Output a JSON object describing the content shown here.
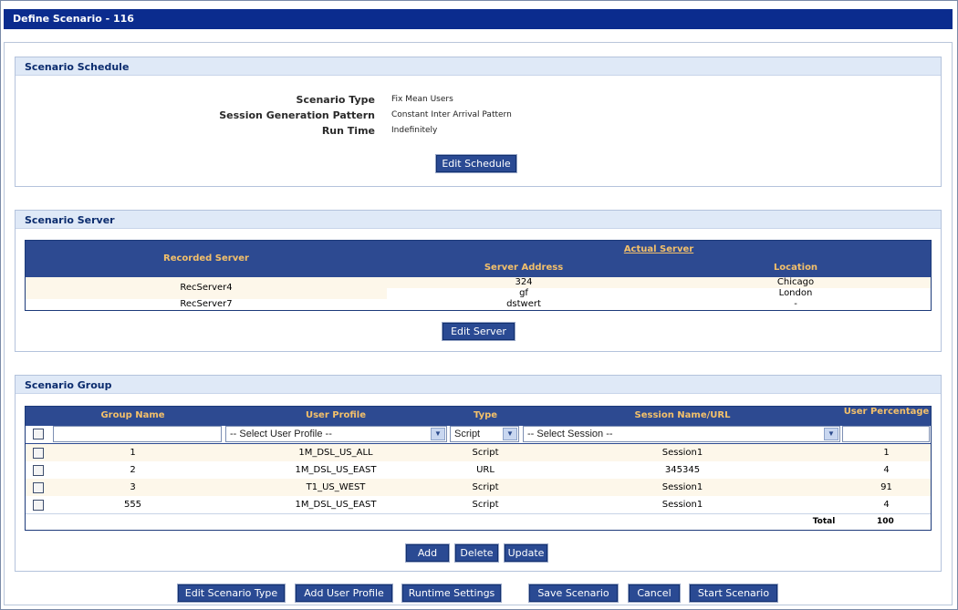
{
  "window": {
    "title": "Define Scenario - 116"
  },
  "schedule": {
    "title": "Scenario Schedule",
    "rows": [
      {
        "label": "Scenario Type",
        "value": "Fix Mean Users"
      },
      {
        "label": "Session Generation Pattern",
        "value": "Constant Inter Arrival Pattern"
      },
      {
        "label": "Run Time",
        "value": "Indefinitely"
      }
    ],
    "edit_button": "Edit Schedule"
  },
  "server": {
    "title": "Scenario Server",
    "headers": {
      "recorded": "Recorded Server",
      "actual": "Actual Server",
      "address": "Server Address",
      "location": "Location"
    },
    "rows": [
      {
        "recorded": "RecServer4",
        "addresses": [
          "324",
          "gf"
        ],
        "locations": [
          "Chicago",
          "London"
        ]
      },
      {
        "recorded": "RecServer7",
        "addresses": [
          "dstwert"
        ],
        "locations": [
          "-"
        ]
      }
    ],
    "edit_button": "Edit Server"
  },
  "group": {
    "title": "Scenario Group",
    "headers": {
      "group_name": "Group Name",
      "user_profile": "User Profile",
      "type": "Type",
      "session": "Session Name/URL",
      "percentage": "User Percentage"
    },
    "filters": {
      "group_name": "",
      "user_profile": "-- Select User Profile --",
      "type": "Script",
      "session": "-- Select Session --",
      "percentage": ""
    },
    "rows": [
      {
        "name": "1",
        "profile": "1M_DSL_US_ALL",
        "type": "Script",
        "session": "Session1",
        "pct": "1"
      },
      {
        "name": "2",
        "profile": "1M_DSL_US_EAST",
        "type": "URL",
        "session": "345345",
        "pct": "4"
      },
      {
        "name": "3",
        "profile": "T1_US_WEST",
        "type": "Script",
        "session": "Session1",
        "pct": "91"
      },
      {
        "name": "555",
        "profile": "1M_DSL_US_EAST",
        "type": "Script",
        "session": "Session1",
        "pct": "4"
      }
    ],
    "total_label": "Total",
    "total_value": "100",
    "buttons": {
      "add": "Add",
      "delete": "Delete",
      "update": "Update"
    }
  },
  "footer_buttons": {
    "edit_type": "Edit Scenario Type",
    "add_profile": "Add User Profile",
    "runtime": "Runtime Settings",
    "save": "Save Scenario",
    "cancel": "Cancel",
    "start": "Start Scenario"
  },
  "colors": {
    "titlebar": "#0b2c8e",
    "header_bg": "#2d4a91",
    "header_text": "#f3c06a",
    "stripe": "#fdf7ea",
    "section_head": "#dfe9f7"
  }
}
